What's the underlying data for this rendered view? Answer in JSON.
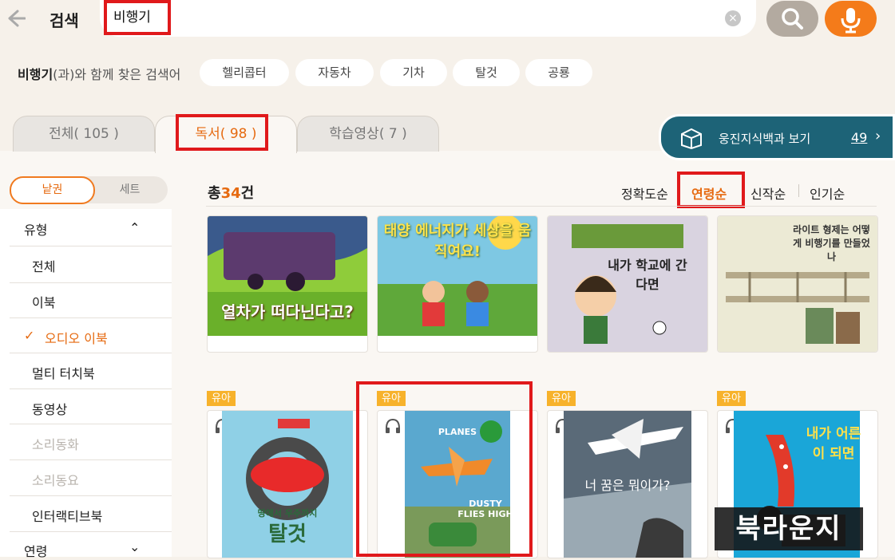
{
  "header": {
    "title": "검색",
    "search_value": "비행기",
    "clear_icon": "×"
  },
  "related": {
    "keyword": "비행기",
    "suffix": "(과)와 함께 찾은 검색어",
    "chips": [
      "헬리콥터",
      "자동차",
      "기차",
      "탈것",
      "공룡"
    ]
  },
  "tabs": {
    "all": "전체( 105 )",
    "reading": "독서( 98 )",
    "video": "학습영상( 7 )"
  },
  "encyclopedia": {
    "label": "웅진지식백과 보기",
    "count": "49",
    "arrow": "›"
  },
  "sidebar": {
    "toggle_single": "낱권",
    "toggle_set": "세트",
    "type_header": "유형",
    "type_chevron": "⌃",
    "items": [
      "전체",
      "이북",
      "오디오 이북",
      "멀티 터치북",
      "동영상",
      "소리동화",
      "소리동요",
      "인터랙티브북"
    ],
    "check_mark": "✓",
    "age_header": "연령",
    "age_chevron": "⌄"
  },
  "results": {
    "total_prefix": "총",
    "total_count": "34",
    "total_suffix": "건",
    "sort_options": [
      "정확도순",
      "연령순",
      "신작순",
      "인기순"
    ],
    "badge_label": "유아"
  },
  "books_row1": [
    {
      "cover_text": "열차가 떠다닌다고?",
      "top_text": ""
    },
    {
      "cover_text": "",
      "top_text": "태양 에너지가 세상을 움직여요!"
    },
    {
      "cover_text": "내가 학교에 간다면",
      "top_text": ""
    },
    {
      "cover_text": "라이트 형제는 어떻게 비행기를 만들었나",
      "top_text": ""
    }
  ],
  "books_row2": [
    {
      "cover_text": "탈것",
      "sub_text": "땅에서 우주까지"
    },
    {
      "cover_text": "DUSTY FLIES HIGH",
      "sub_text": "PLANES"
    },
    {
      "cover_text": "너 꿈은 뭐이가?",
      "sub_text": ""
    },
    {
      "cover_text": "내가 어른이 되면",
      "sub_text": ""
    }
  ],
  "watermark": "북라운지",
  "colors": {
    "accent_orange": "#e66a10",
    "highlight_red": "#e0191b",
    "encyc_teal": "#1d6377",
    "badge_yellow": "#f7b22b"
  }
}
